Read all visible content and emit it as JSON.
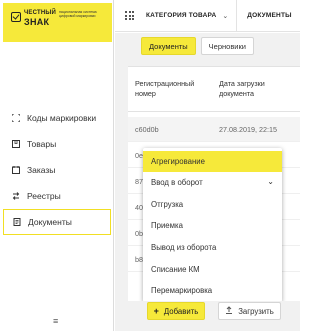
{
  "logo": {
    "line1": "ЧЕСТНЫЙ",
    "line2": "ЗНАК",
    "tagline": "национальная система цифровой маркировки"
  },
  "topbar": {
    "category_label": "КАТЕГОРИЯ ТОВАРА",
    "documents_label": "ДОКУМЕНТЫ"
  },
  "sidebar": {
    "items": [
      {
        "label": "Коды маркировки",
        "icon": "scan-icon"
      },
      {
        "label": "Товары",
        "icon": "box-icon"
      },
      {
        "label": "Заказы",
        "icon": "order-icon"
      },
      {
        "label": "Реестры",
        "icon": "registry-icon"
      },
      {
        "label": "Документы",
        "icon": "document-icon"
      }
    ],
    "bottom_icon": "≡"
  },
  "tabs": {
    "documents": "Документы",
    "drafts": "Черновики"
  },
  "table": {
    "headers": [
      "Регистрационный номер",
      "Дата загрузки документа"
    ],
    "rows": [
      {
        "id": "c60d0b",
        "date": "27.08.2019, 22:15"
      },
      {
        "id": "0e",
        "date": ""
      },
      {
        "id": "87",
        "date": ""
      },
      {
        "id": "40",
        "date": ""
      },
      {
        "id": "0b",
        "date": ""
      },
      {
        "id": "b8",
        "date": ""
      }
    ]
  },
  "dropdown": {
    "items": [
      "Агрегирование",
      "Ввод в оборот",
      "Отгрузка",
      "Приемка",
      "Вывод из оборота",
      "Списание КМ",
      "Перемаркировка"
    ]
  },
  "footer": {
    "add_label": "Добавить",
    "upload_label": "Загрузить"
  },
  "colors": {
    "accent": "#f6e93a",
    "background": "#f1f1f1"
  }
}
